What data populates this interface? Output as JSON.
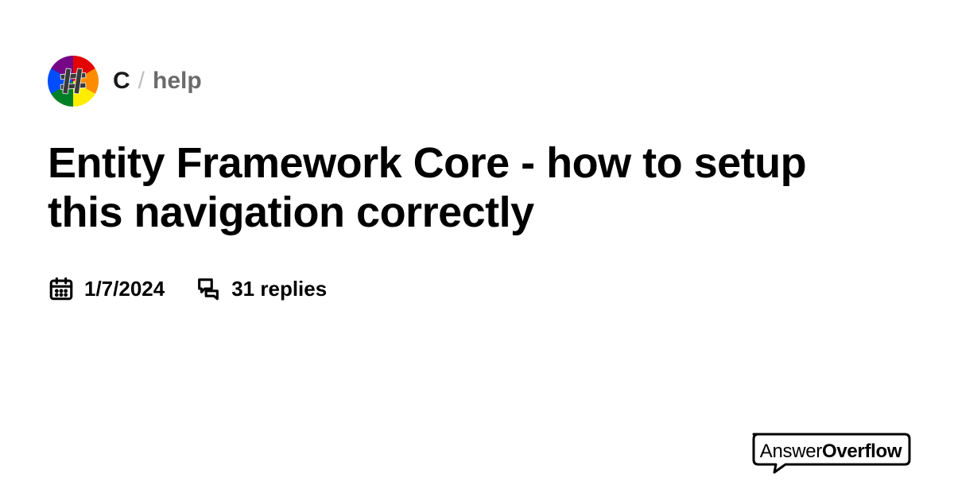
{
  "breadcrumb": {
    "community": "C",
    "separator": "/",
    "channel": "help"
  },
  "title": "Entity Framework Core - how to setup this navigation correctly",
  "meta": {
    "date": "1/7/2024",
    "replies": "31 replies"
  },
  "logo": {
    "part1": "Answer",
    "part2": "Overflow"
  }
}
